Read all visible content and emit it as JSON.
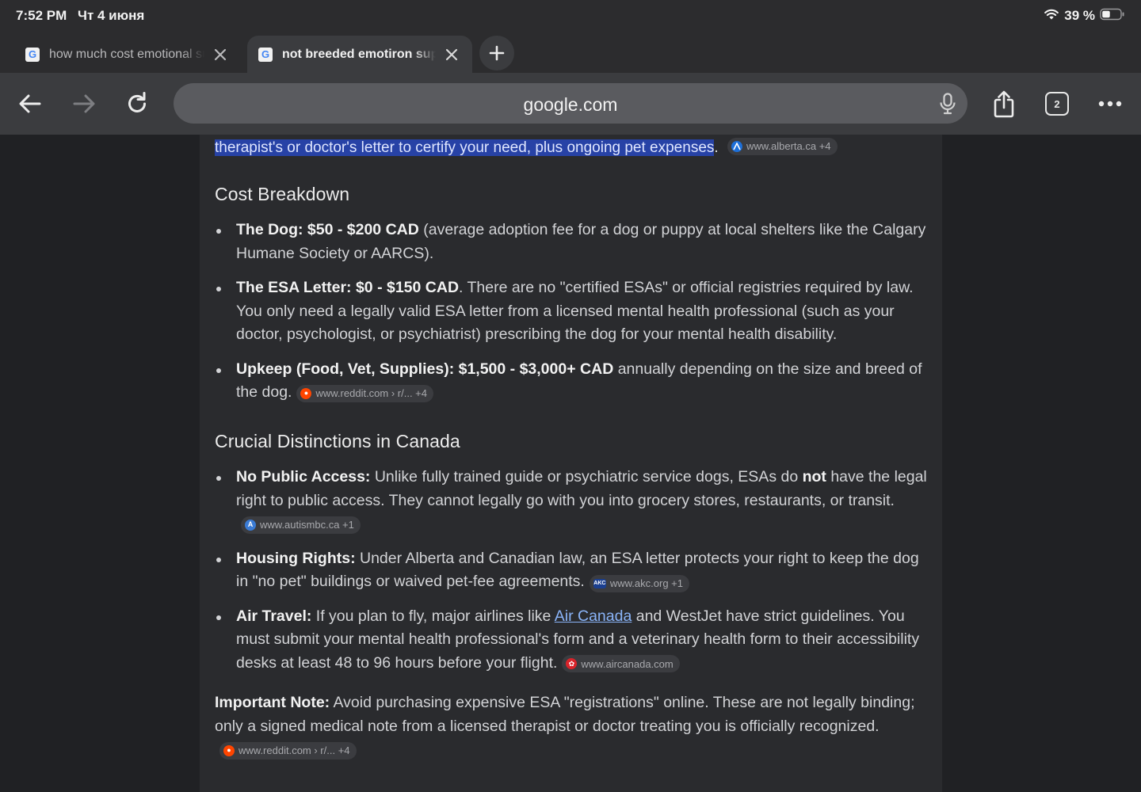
{
  "status_bar": {
    "time": "7:52 PM",
    "date": "Чт 4 июня",
    "battery": "39 %"
  },
  "tabs": [
    {
      "title": "how much cost emotional support dog in Alberta",
      "favicon": "G",
      "active": false
    },
    {
      "title": "not breeded emotiron support dog Alberta",
      "favicon": "G",
      "active": true
    }
  ],
  "toolbar": {
    "url": "google.com",
    "tab_count": "2"
  },
  "content": {
    "highlight_text": "therapist's or doctor's letter to certify your need, plus ongoing pet expenses",
    "highlight_end": ".",
    "highlight_source": "www.alberta.ca +4",
    "cost_heading": "Cost Breakdown",
    "cost_items": [
      {
        "label": "The Dog: $50 - $200 CAD",
        "text": " (average adoption fee for a dog or puppy at local shelters like the Calgary Humane Society or AARCS)."
      },
      {
        "label": "The ESA Letter: $0 - $150 CAD",
        "text": ". There are no \"certified ESAs\" or official registries required by law. You only need a legally valid ESA letter from a licensed mental health professional (such as your doctor, psychologist, or psychiatrist) prescribing the dog for your mental health disability."
      },
      {
        "label": "Upkeep (Food, Vet, Supplies): $1,500 - $3,000+ CAD",
        "text": " annually depending on the size and breed of the dog.",
        "source": "www.reddit.com › r/... +4"
      }
    ],
    "dist_heading": "Crucial Distinctions in Canada",
    "dist_items": [
      {
        "label": "No Public Access:",
        "text_a": " Unlike fully trained guide or psychiatric service dogs, ESAs do ",
        "bold_mid": "not",
        "text_b": " have the legal right to public access. They cannot legally go with you into grocery stores, restaurants, or transit.",
        "source": "www.autismbc.ca +1"
      },
      {
        "label": "Housing Rights:",
        "text": " Under Alberta and Canadian law, an ESA letter protects your right to keep the dog in \"no pet\" buildings or waived pet-fee agreements.",
        "source": "www.akc.org +1"
      },
      {
        "label": "Air Travel:",
        "text_a": " If you plan to fly, major airlines like ",
        "link": "Air Canada",
        "text_b": " and WestJet have strict guidelines. You must submit your mental health professional's form and a veterinary health form to their accessibility desks at least 48 to 96 hours before your flight.",
        "source": "www.aircanada.com"
      }
    ],
    "note_label": "Important Note:",
    "note_text": " Avoid purchasing expensive ESA \"registrations\" online. These are not legally binding; only a signed medical note from a licensed therapist or doctor treating you is officially recognized.",
    "note_source": "www.reddit.com › r/... +4"
  },
  "icons": {
    "back": "arrow-left-icon",
    "forward": "arrow-right-icon",
    "reload": "reload-icon",
    "mic": "microphone-icon",
    "share": "share-icon",
    "tabs": "tab-switcher-icon",
    "more": "more-icon",
    "wifi": "wifi-icon",
    "battery": "battery-icon"
  },
  "colors": {
    "highlight": "#2742a6",
    "link": "#8ab4f8",
    "reddit": "#ff4500",
    "aircanada": "#d8232a"
  }
}
